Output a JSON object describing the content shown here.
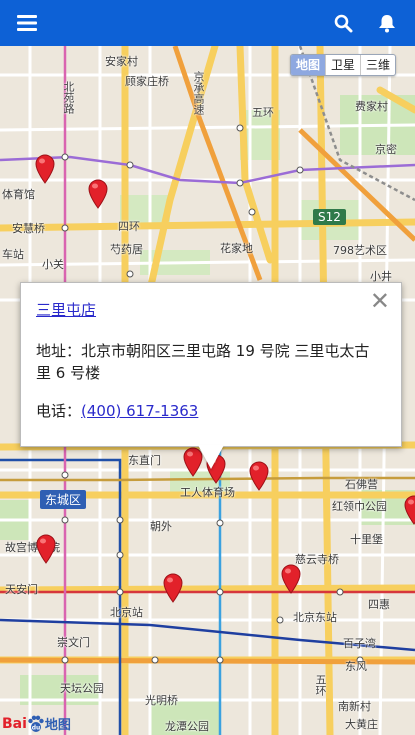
{
  "header": {
    "menu_icon": "hamburger-menu-icon",
    "search_icon": "search-icon",
    "notification_icon": "bell-icon",
    "color": "#0d61d6"
  },
  "map_type_switch": {
    "map": "地图",
    "satellite": "卫星",
    "3d": "三维",
    "selected": "地图"
  },
  "map_labels": {
    "anding": "安家村",
    "gulou": "顾家庄桥",
    "beiyuan_road": "北苑路",
    "jingcheng": "京承高速",
    "wuhuan": "五环",
    "feijia": "费家村",
    "jingmi": "京密",
    "tiyu": "体育馆",
    "anhui": "安慧桥",
    "sihuan": "四环",
    "s12": "S12",
    "huajia": "花家地",
    "yuan798": "798艺术区",
    "shaoyao": "芍药居",
    "xiaoguan": "小关",
    "xiaojing": "小井",
    "chezhan": "车站",
    "dongzhimen": "东直门",
    "gongti": "工人体育场",
    "shifo": "石佛营",
    "dongcheng": "东城区",
    "hongling": "红领巾公园",
    "chaowai": "朝外",
    "gugong": "故宫博物院",
    "shilibao": "十里堡",
    "ciyun": "慈云寺桥",
    "tiananmen": "天安门",
    "beijingzhan": "北京站",
    "beijingdong": "北京东站",
    "sihui": "四惠",
    "chongwen": "崇文门",
    "baiziwan": "百子湾",
    "tiantan": "天坛公园",
    "guangming": "光明桥",
    "dongfeng": "东风",
    "ringname": "五环",
    "nanxin": "南新村",
    "longtan": "龙潭公园",
    "dahuangzhuang": "大黄庄"
  },
  "popup": {
    "title": "三里屯店",
    "address": "地址：北京市朝阳区三里屯路 19 号院 三里屯太古里 6 号楼",
    "phone_label": "电话：",
    "phone": "(400) 617-1363",
    "close_label": "✕"
  },
  "logo": {
    "text_bai": "Bai",
    "text_du": "du",
    "text_map": "地图"
  }
}
